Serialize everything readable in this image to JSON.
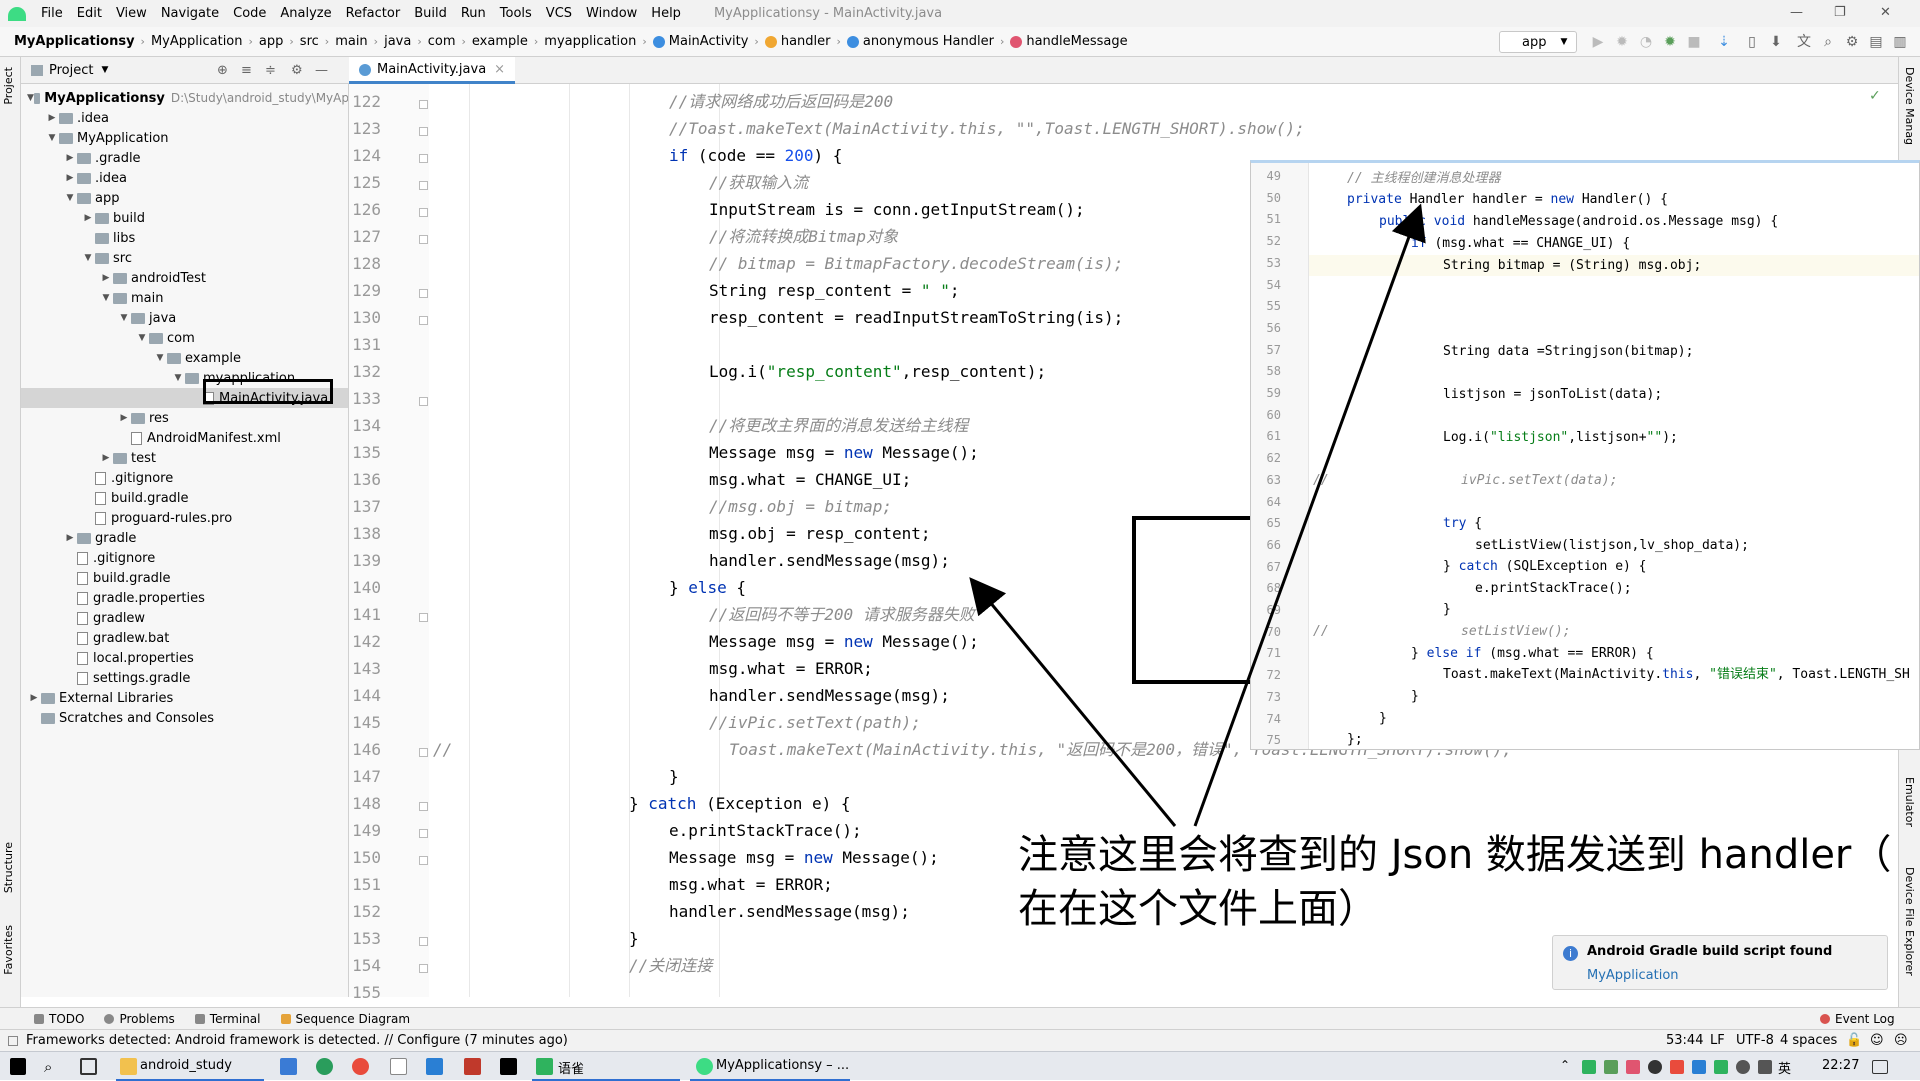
{
  "window": {
    "title": "MyApplicationsy - MainActivity.java"
  },
  "menu": [
    "File",
    "Edit",
    "View",
    "Navigate",
    "Code",
    "Analyze",
    "Refactor",
    "Build",
    "Run",
    "Tools",
    "VCS",
    "Window",
    "Help"
  ],
  "breadcrumb": [
    "MyApplicationsy",
    "MyApplication",
    "app",
    "src",
    "main",
    "java",
    "com",
    "example",
    "myapplication",
    "MainActivity",
    "handler",
    "anonymous Handler",
    "handleMessage"
  ],
  "run_config": "app",
  "project_panel": {
    "title": "Project",
    "root_path": "D:\\Study\\android_study\\MyAp",
    "tree": [
      "MyApplicationsy",
      ".idea",
      "MyApplication",
      ".gradle",
      ".idea",
      "app",
      "build",
      "libs",
      "src",
      "androidTest",
      "main",
      "java",
      "com",
      "example",
      "myapplication",
      "MainActivity.java",
      "res",
      "AndroidManifest.xml",
      "test",
      ".gitignore",
      "build.gradle",
      "proguard-rules.pro",
      "gradle",
      ".gitignore",
      "build.gradle",
      "gradle.properties",
      "gradlew",
      "gradlew.bat",
      "local.properties",
      "settings.gradle",
      "External Libraries",
      "Scratches and Consoles"
    ]
  },
  "editor": {
    "tab": "MainActivity.java",
    "line_numbers": [
      "122",
      "123",
      "124",
      "125",
      "126",
      "127",
      "128",
      "129",
      "130",
      "131",
      "132",
      "133",
      "134",
      "135",
      "136",
      "137",
      "138",
      "139",
      "140",
      "141",
      "142",
      "143",
      "144",
      "145",
      "146",
      "147",
      "148",
      "149",
      "150",
      "151",
      "152",
      "153",
      "154",
      "155"
    ]
  },
  "popup": {
    "line_numbers": [
      "49",
      "50",
      "51",
      "52",
      "53",
      "54",
      "55",
      "56",
      "57",
      "58",
      "59",
      "60",
      "61",
      "62",
      "63",
      "64",
      "65",
      "66",
      "67",
      "68",
      "69",
      "70",
      "71",
      "72",
      "73",
      "74",
      "75"
    ]
  },
  "annotation": {
    "line1": "注意这里会将查到的 Json 数据发送到 handler（",
    "line2": "在在这个文件上面）"
  },
  "notification": {
    "title": "Android Gradle build script found",
    "link": "MyApplication"
  },
  "bottom_tabs": [
    "TODO",
    "Problems",
    "Terminal",
    "Sequence Diagram"
  ],
  "event_log": "Event Log",
  "status": {
    "message": "Frameworks detected: Android framework is detected. // Configure (7 minutes ago)",
    "position": "53:44",
    "line_sep": "LF",
    "encoding": "UTF-8",
    "indent": "4 spaces"
  },
  "side_labels": {
    "project": "Project",
    "structure": "Structure",
    "favorites": "Favorites",
    "device_manager": "Device Manag",
    "emulator": "Emulator",
    "device_file_explorer": "Device File Explorer"
  },
  "taskbar": {
    "items": [
      "android_study",
      "语雀",
      "MyApplicationsy – ..."
    ],
    "time": "22:27",
    "ime": "英"
  }
}
